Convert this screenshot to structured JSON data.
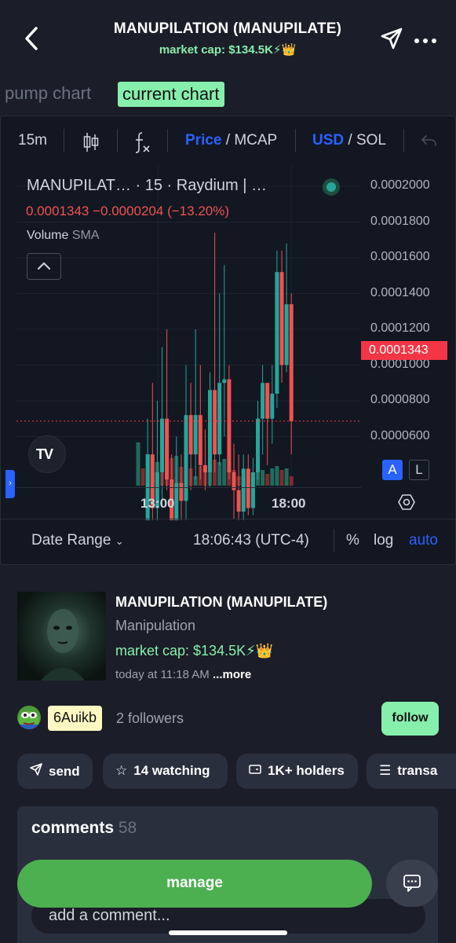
{
  "header": {
    "title": "MANUPILATION (MANUPILATE)",
    "market_cap": "market cap: $134.5K⚡👑"
  },
  "chart_tabs": {
    "pump": "pump chart",
    "current": "current chart"
  },
  "toolbar": {
    "interval": "15m",
    "price": "Price",
    "slash1": " / ",
    "mcap": "MCAP",
    "usd": "USD",
    "slash2": " / ",
    "sol": "SOL"
  },
  "chart": {
    "symbol_title": "MANUPILAT…  · 15 · Raydium | …",
    "ohlc_text": "0.0001343  −0.0000204 (−13.20%)",
    "volume_label": "Volume",
    "volume_ma": "SMA",
    "current_price": "0.0001343",
    "y_ticks": [
      "0.0002000",
      "0.0001800",
      "0.0001600",
      "0.0001400",
      "0.0001200",
      "0.0001000",
      "0.0000800",
      "0.0000600"
    ],
    "x_ticks": [
      "13:00",
      "18:00"
    ],
    "scale_a": "A",
    "scale_l": "L",
    "logo_text": "TV"
  },
  "chart_bottom": {
    "date_range": "Date Range",
    "time": "18:06:43 (UTC-4)",
    "percent": "%",
    "log": "log",
    "auto": "auto"
  },
  "coin": {
    "name": "MANUPILATION (MANUPILATE)",
    "ticker": "Manipulation",
    "market_cap": "market cap: $134.5K⚡👑",
    "created": "today at 11:18 AM",
    "more": "...more"
  },
  "creator": {
    "handle": "6Auikb",
    "followers": "2 followers",
    "follow_label": "follow"
  },
  "actions": {
    "send": "send",
    "watching": "14 watching",
    "holders": "1K+ holders",
    "transactions": "transa"
  },
  "comments": {
    "title": "comments",
    "count": "58",
    "placeholder": "add a comment..."
  },
  "manage_label": "manage",
  "colors": {
    "accent_green": "#86efac",
    "candle_up": "#26a69a",
    "candle_down": "#ef5350",
    "tv_blue": "#2962ff",
    "manage_green": "#4caf50"
  },
  "chart_data": {
    "type": "candlestick",
    "interval": "15m",
    "currency": "USD",
    "ylim": [
      5e-05,
      0.00021
    ],
    "current_price": 0.0001343,
    "change": -2.04e-05,
    "change_pct": -13.2,
    "candles": [
      {
        "o": 6e-05,
        "h": 8.8e-05,
        "l": 5.8e-05,
        "c": 8.5e-05
      },
      {
        "o": 8.5e-05,
        "h": 0.000105,
        "l": 7e-05,
        "c": 9.5e-05
      },
      {
        "o": 9.5e-05,
        "h": 0.000135,
        "l": 8.8e-05,
        "c": 0.000125
      },
      {
        "o": 0.000125,
        "h": 0.000145,
        "l": 0.000105,
        "c": 0.00011
      },
      {
        "o": 0.00011,
        "h": 0.00014,
        "l": 0.0001,
        "c": 0.00012
      },
      {
        "o": 0.00012,
        "h": 0.000155,
        "l": 0.00011,
        "c": 0.000135
      },
      {
        "o": 0.000135,
        "h": 0.00016,
        "l": 0.000115,
        "c": 0.000118
      },
      {
        "o": 0.000118,
        "h": 0.000125,
        "l": 9.6e-05,
        "c": 0.000102
      },
      {
        "o": 0.000102,
        "h": 0.00013,
        "l": 9.8e-05,
        "c": 0.000117
      },
      {
        "o": 0.000117,
        "h": 0.000125,
        "l": 0.0001,
        "c": 0.000112
      },
      {
        "o": 0.000112,
        "h": 0.00015,
        "l": 8.5e-05,
        "c": 0.000136
      },
      {
        "o": 0.000136,
        "h": 0.000145,
        "l": 0.000115,
        "c": 0.000125
      },
      {
        "o": 0.000125,
        "h": 0.00016,
        "l": 0.000118,
        "c": 0.000136
      },
      {
        "o": 0.000136,
        "h": 0.00015,
        "l": 0.000118,
        "c": 0.000122
      },
      {
        "o": 0.000122,
        "h": 0.000132,
        "l": 0.000115,
        "c": 0.00012
      },
      {
        "o": 0.00012,
        "h": 0.000148,
        "l": 0.000116,
        "c": 0.000143
      },
      {
        "o": 0.000143,
        "h": 0.000187,
        "l": 0.00012,
        "c": 0.000125
      },
      {
        "o": 0.000125,
        "h": 0.00017,
        "l": 0.000122,
        "c": 0.000145
      },
      {
        "o": 0.000145,
        "h": 0.000178,
        "l": 0.00013,
        "c": 0.000146
      },
      {
        "o": 0.000146,
        "h": 0.00015,
        "l": 0.000118,
        "c": 0.00012
      },
      {
        "o": 0.00012,
        "h": 0.000128,
        "l": 0.000107,
        "c": 0.000115
      },
      {
        "o": 0.000115,
        "h": 0.000125,
        "l": 0.0001,
        "c": 0.000109
      },
      {
        "o": 0.000109,
        "h": 0.000125,
        "l": 0.000105,
        "c": 0.000121
      },
      {
        "o": 0.000121,
        "h": 0.000125,
        "l": 0.000108,
        "c": 0.00011
      },
      {
        "o": 0.00011,
        "h": 0.000124,
        "l": 0.000108,
        "c": 0.00012
      },
      {
        "o": 0.00012,
        "h": 0.00014,
        "l": 0.000118,
        "c": 0.000135
      },
      {
        "o": 0.000135,
        "h": 0.00015,
        "l": 0.000125,
        "c": 0.000145
      },
      {
        "o": 0.000145,
        "h": 0.00014,
        "l": 0.000122,
        "c": 0.000135
      },
      {
        "o": 0.000135,
        "h": 0.00015,
        "l": 0.000128,
        "c": 0.000142
      },
      {
        "o": 0.000142,
        "h": 0.000182,
        "l": 0.000138,
        "c": 0.000176
      },
      {
        "o": 0.000176,
        "h": 0.000182,
        "l": 0.000145,
        "c": 0.00015
      },
      {
        "o": 0.00015,
        "h": 0.000184,
        "l": 0.000148,
        "c": 0.000167
      },
      {
        "o": 0.000167,
        "h": 0.00017,
        "l": 0.000125,
        "c": 0.0001343
      }
    ],
    "volume": [
      {
        "v": 55,
        "up": true
      },
      {
        "v": 22,
        "up": false
      },
      {
        "v": 40,
        "up": true
      },
      {
        "v": 18,
        "up": false
      },
      {
        "v": 30,
        "up": true
      },
      {
        "v": 55,
        "up": false
      },
      {
        "v": 52,
        "up": false
      },
      {
        "v": 35,
        "up": false
      },
      {
        "v": 38,
        "up": true
      },
      {
        "v": 24,
        "up": false
      },
      {
        "v": 50,
        "up": true
      },
      {
        "v": 22,
        "up": false
      },
      {
        "v": 12,
        "up": true
      },
      {
        "v": 25,
        "up": false
      },
      {
        "v": 20,
        "up": false
      },
      {
        "v": 34,
        "up": true
      },
      {
        "v": 33,
        "up": false
      },
      {
        "v": 30,
        "up": true
      },
      {
        "v": 34,
        "up": true
      },
      {
        "v": 22,
        "up": false
      },
      {
        "v": 20,
        "up": false
      },
      {
        "v": 12,
        "up": false
      },
      {
        "v": 10,
        "up": true
      },
      {
        "v": 14,
        "up": false
      },
      {
        "v": 10,
        "up": true
      },
      {
        "v": 20,
        "up": true
      },
      {
        "v": 20,
        "up": true
      },
      {
        "v": 15,
        "up": false
      },
      {
        "v": 22,
        "up": true
      },
      {
        "v": 25,
        "up": true
      },
      {
        "v": 20,
        "up": false
      },
      {
        "v": 22,
        "up": true
      },
      {
        "v": 12,
        "up": false
      }
    ]
  }
}
